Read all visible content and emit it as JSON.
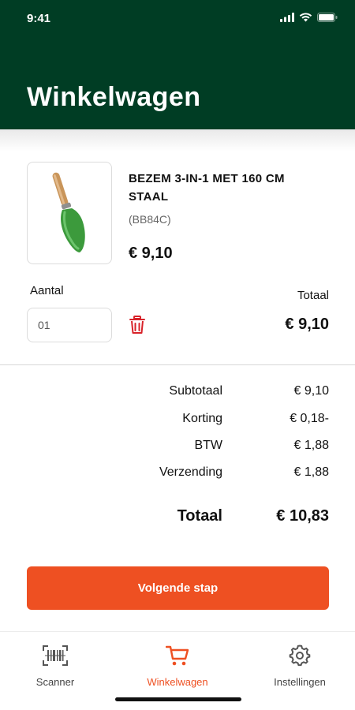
{
  "status_bar": {
    "time": "9:41"
  },
  "header": {
    "title": "Winkelwagen"
  },
  "product": {
    "name": "BEZEM 3-IN-1 MET 160 CM STAAL",
    "sku": "(BB84C)",
    "price": "€ 9,10",
    "image_icon": "garden-trowel"
  },
  "quantity": {
    "label": "Aantal",
    "value": "01"
  },
  "line_total": {
    "label": "Totaal",
    "value": "€ 9,10"
  },
  "summary": {
    "rows": [
      {
        "label": "Subtotaal",
        "value": "€ 9,10"
      },
      {
        "label": "Korting",
        "value": "€ 0,18-"
      },
      {
        "label": "BTW",
        "value": "€ 1,88"
      },
      {
        "label": "Verzending",
        "value": "€ 1,88"
      }
    ],
    "total": {
      "label": "Totaal",
      "value": "€ 10,83"
    }
  },
  "cta": {
    "label": "Volgende stap"
  },
  "tabs": [
    {
      "label": "Scanner",
      "icon": "barcode-scanner",
      "active": false
    },
    {
      "label": "Winkelwagen",
      "icon": "shopping-cart",
      "active": true
    },
    {
      "label": "Instellingen",
      "icon": "gear",
      "active": false
    }
  ],
  "colors": {
    "header_bg": "#003d24",
    "accent": "#ee5022",
    "delete": "#d8232a"
  }
}
